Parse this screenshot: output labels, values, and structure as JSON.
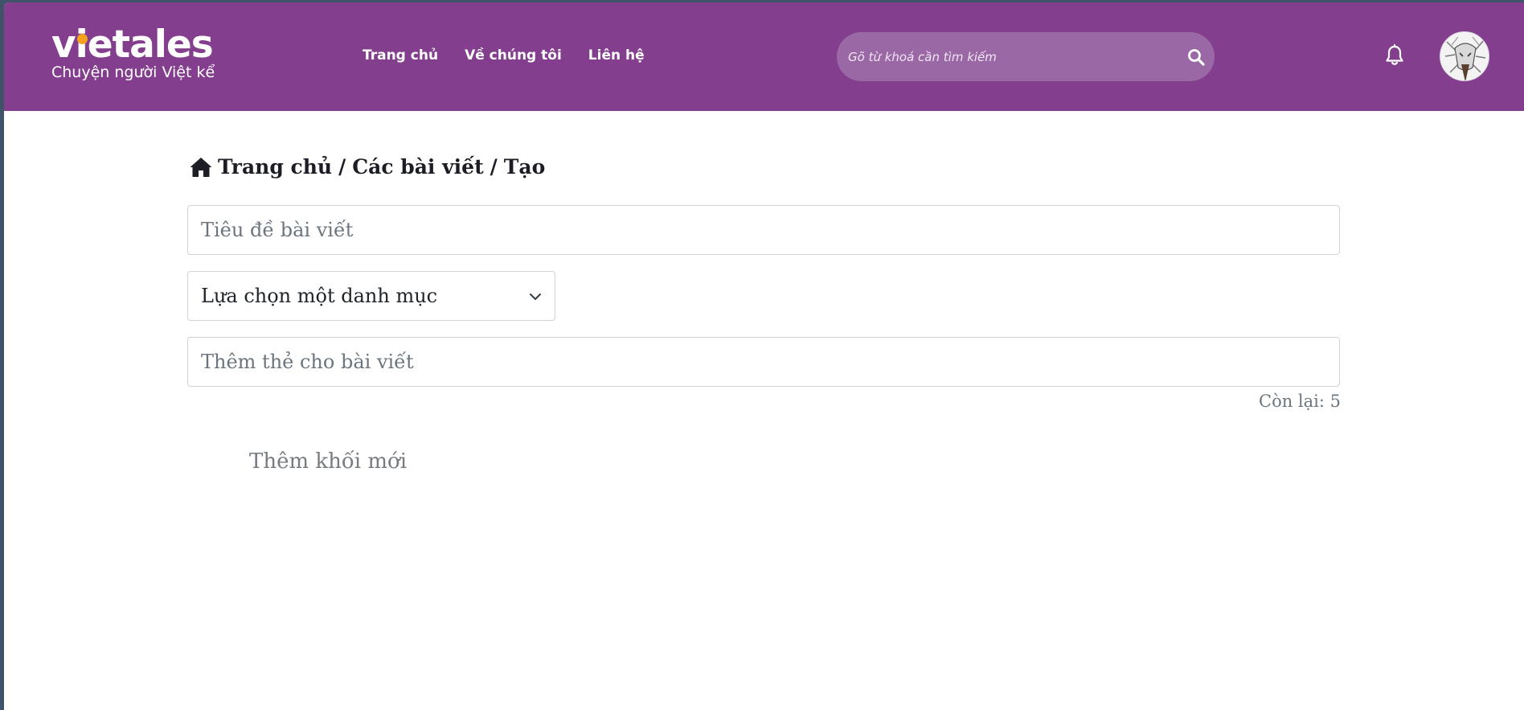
{
  "header": {
    "logo_text": "vietales",
    "logo_tagline": "Chuyện người Việt kể",
    "nav": [
      {
        "label": "Trang chủ"
      },
      {
        "label": "Về chúng tôi"
      },
      {
        "label": "Liên hệ"
      }
    ],
    "search": {
      "placeholder": "Gõ từ khoá cần tìm kiếm"
    },
    "icons": {
      "search": "search-icon",
      "notifications": "bell-icon",
      "avatar": "avatar"
    }
  },
  "breadcrumb": {
    "home_icon": "home-icon",
    "items": [
      "Trang chủ",
      "Các bài viết",
      "Tạo"
    ],
    "separator": "/"
  },
  "form": {
    "title_placeholder": "Tiêu đề bài viết",
    "category_selected": "Lựa chọn một danh mục",
    "tags_placeholder": "Thêm thẻ cho bài viết",
    "remaining_label": "Còn lại: 5",
    "add_block_placeholder": "Thêm khối mới"
  },
  "colors": {
    "header_bg": "#843e8e",
    "search_bg": "#9b68a6",
    "logo_dot": "#f4a11e",
    "page_bg": "#ffffff",
    "desktop_bg": "#3f5468"
  }
}
